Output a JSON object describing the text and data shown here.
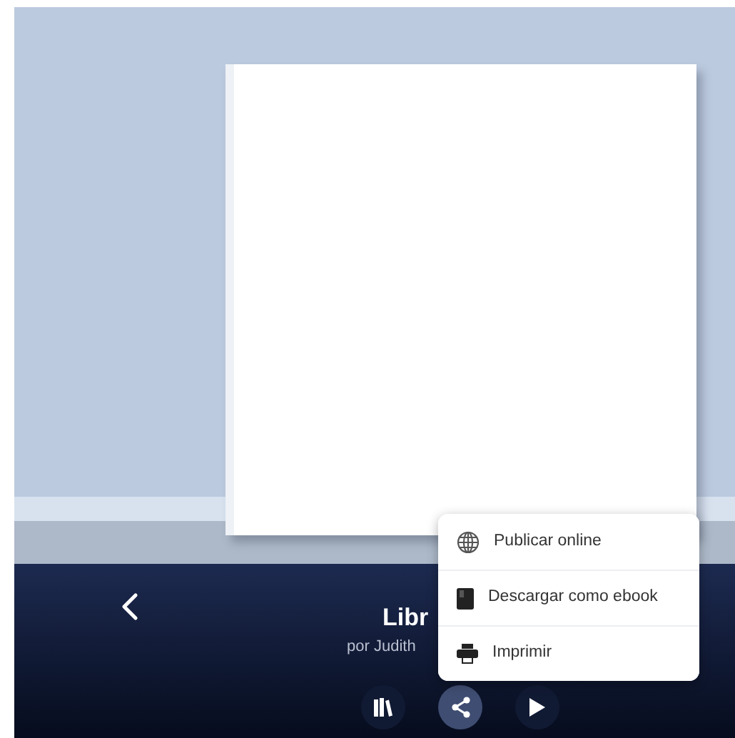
{
  "book": {
    "title": "Libr",
    "author": "por Judith"
  },
  "menu": [
    {
      "label": "Publicar online"
    },
    {
      "label": "Descargar como ebook"
    },
    {
      "label": "Imprimir"
    }
  ],
  "toolbar": [
    {
      "selected": false
    },
    {
      "selected": true
    },
    {
      "selected": false
    }
  ]
}
